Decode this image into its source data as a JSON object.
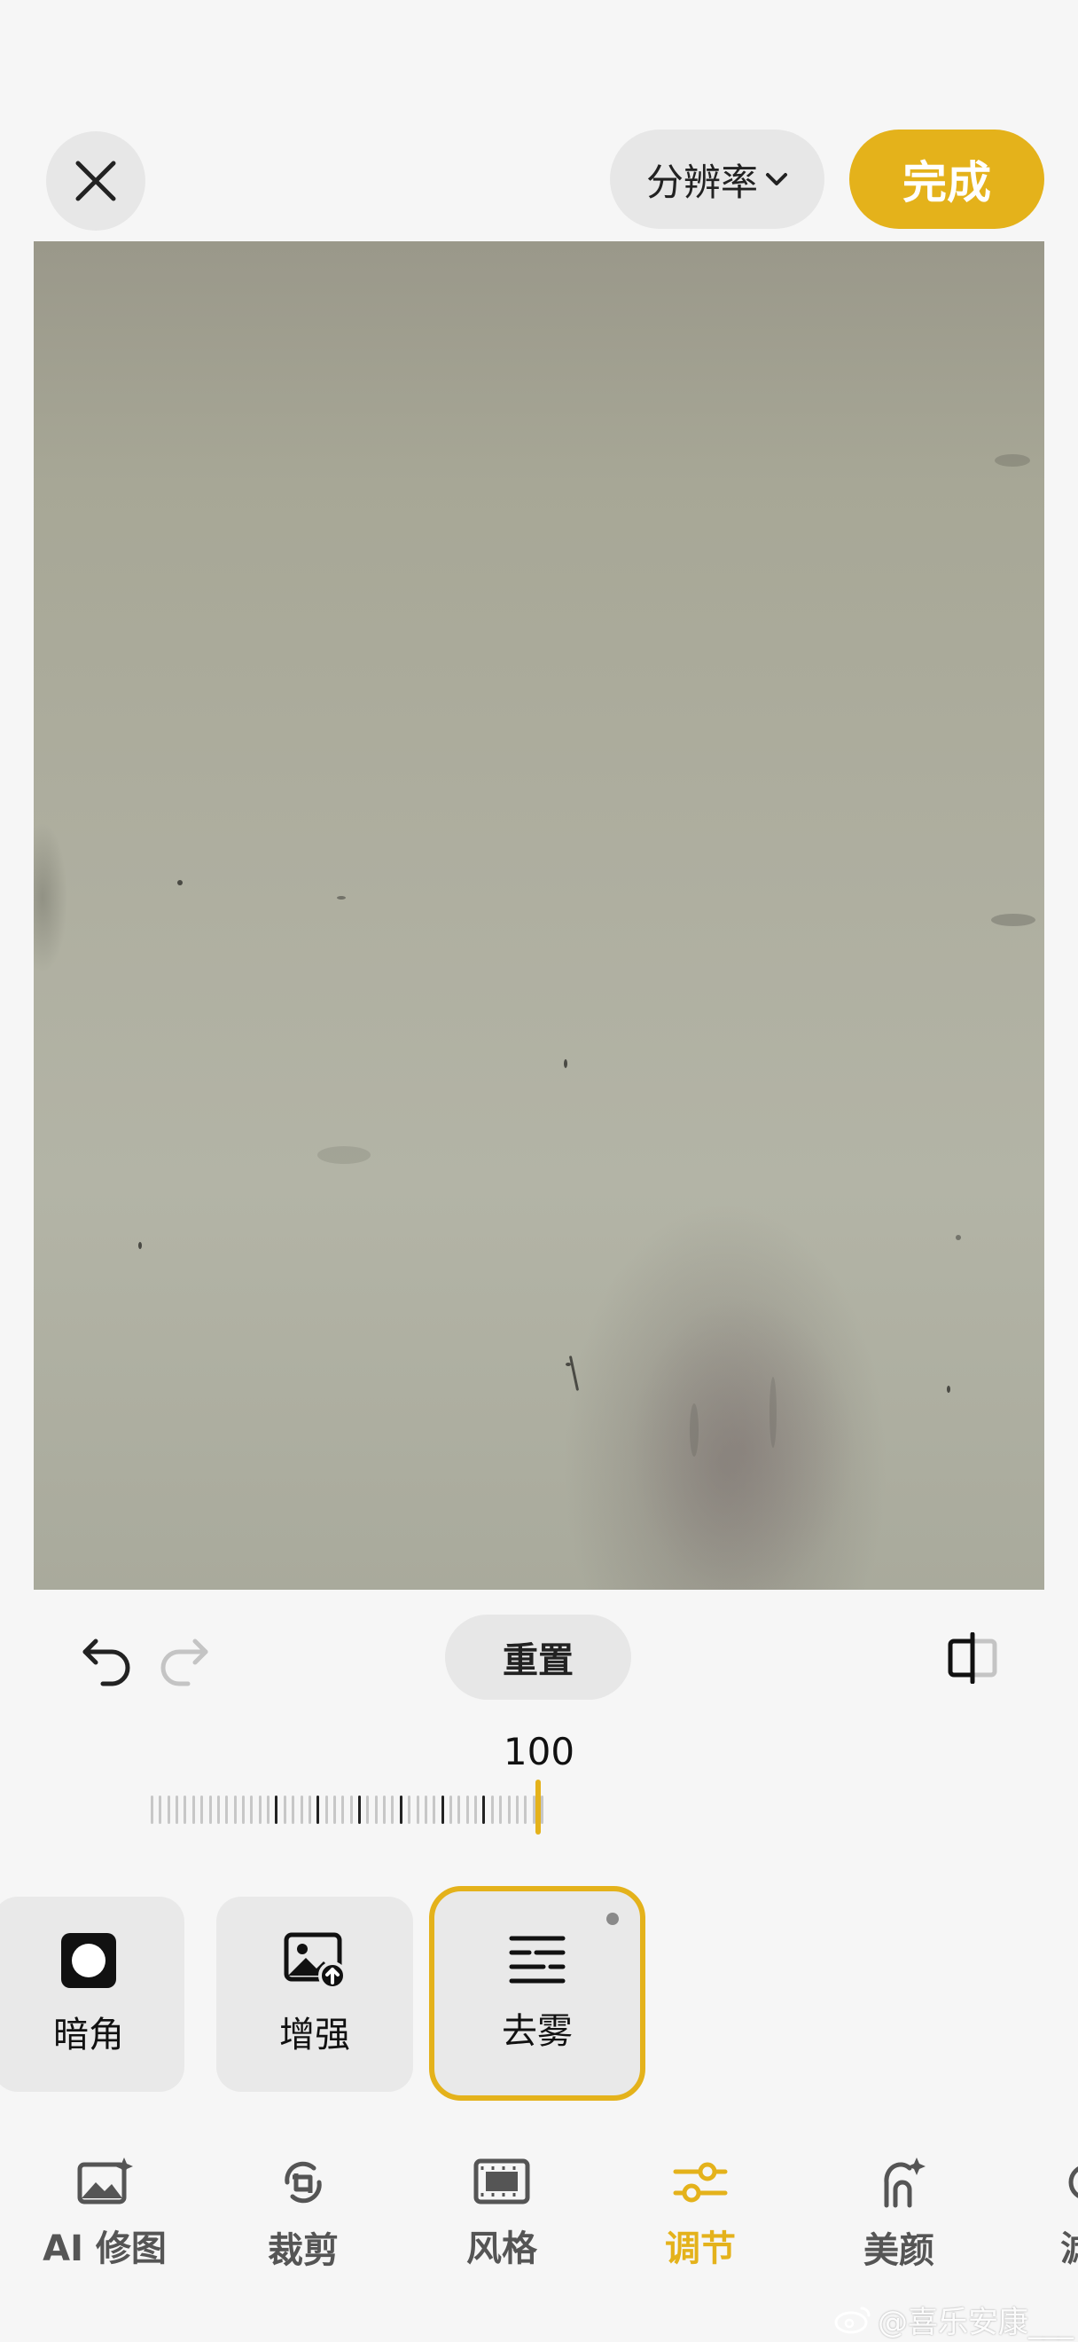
{
  "top_bar": {
    "resolution_label": "分辨率",
    "done_label": "完成"
  },
  "edit_controls": {
    "reset_label": "重置"
  },
  "slider": {
    "value_label": "100",
    "value": 100
  },
  "tools": [
    {
      "label": "暗角",
      "icon": "vignette-icon"
    },
    {
      "label": "增强",
      "icon": "enhance-image-icon"
    },
    {
      "label": "去雾",
      "icon": "dehaze-icon",
      "selected": true
    }
  ],
  "bottom_nav": [
    {
      "label": "AI 修图",
      "icon": "ai-retouch-icon"
    },
    {
      "label": "裁剪",
      "icon": "crop-rotate-icon"
    },
    {
      "label": "风格",
      "icon": "film-style-icon"
    },
    {
      "label": "调节",
      "icon": "adjust-sliders-icon",
      "active": true
    },
    {
      "label": "美颜",
      "icon": "beauty-face-icon"
    },
    {
      "label": "滤",
      "icon": "filter-icon"
    }
  ],
  "watermark": "@喜乐安康___",
  "colors": {
    "accent": "#e4b21b",
    "background": "#f6f6f6",
    "chip": "#e7e7e7"
  }
}
